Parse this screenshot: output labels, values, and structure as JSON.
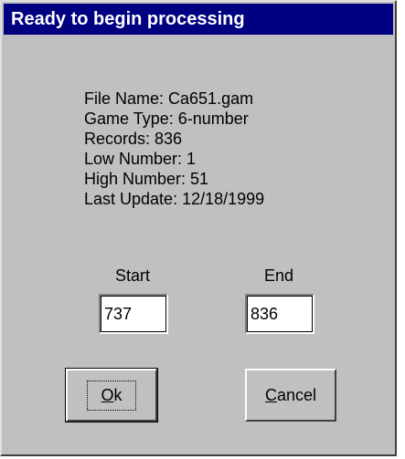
{
  "window": {
    "title": "Ready to begin processing"
  },
  "info": {
    "file_name": "File Name: Ca651.gam",
    "game_type": "Game Type: 6-number",
    "records": "Records: 836",
    "low_number": "Low Number: 1",
    "high_number": "High Number: 51",
    "last_update": "Last Update: 12/18/1999"
  },
  "range": {
    "start_label": "Start",
    "start_value": "737",
    "end_label": "End",
    "end_value": "836"
  },
  "buttons": {
    "ok_mnemonic": "O",
    "ok_rest": "k",
    "cancel_mnemonic": "C",
    "cancel_rest": "ancel"
  }
}
